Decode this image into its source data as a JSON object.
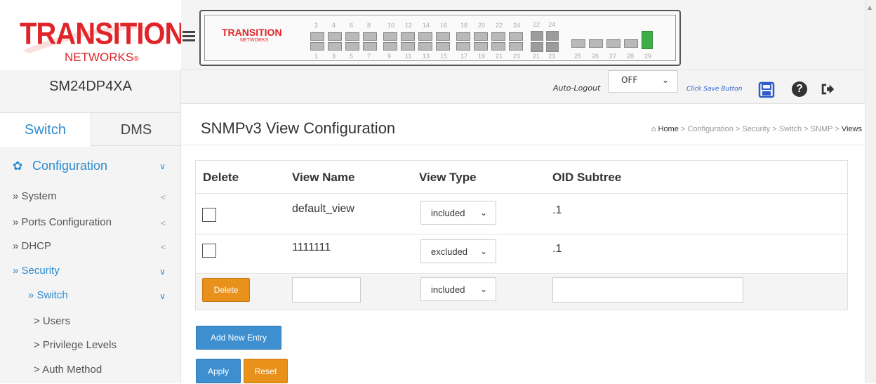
{
  "brand": {
    "logo_top": "TRANSITION",
    "logo_bottom": "NETWORKS",
    "logo_mark": "®"
  },
  "device": {
    "name": "SM24DP4XA"
  },
  "sidebar": {
    "tabs": [
      {
        "label": "Switch"
      },
      {
        "label": "DMS"
      }
    ],
    "items": [
      {
        "label": "Configuration"
      },
      {
        "label": "» System"
      },
      {
        "label": "» Ports Configuration"
      },
      {
        "label": "» DHCP"
      },
      {
        "label": "» Security"
      },
      {
        "label": "» Switch"
      },
      {
        "label": "> Users"
      },
      {
        "label": "> Privilege Levels"
      },
      {
        "label": "> Auth Method"
      }
    ]
  },
  "panel": {
    "logo_top": "TRANSITION",
    "logo_bottom": "NETWORKS",
    "top_numbers": [
      "2",
      "4",
      "6",
      "8",
      "10",
      "12",
      "14",
      "16",
      "18",
      "20",
      "22",
      "24",
      "22",
      "24"
    ],
    "bottom_numbers": [
      "1",
      "3",
      "5",
      "7",
      "9",
      "11",
      "13",
      "15",
      "17",
      "19",
      "21",
      "23",
      "21",
      "23",
      "25",
      "26",
      "27",
      "28",
      "29"
    ]
  },
  "header": {
    "autologout_label": "Auto-Logout",
    "autologout_value": "OFF",
    "click_save": "Click Save Button",
    "icons": [
      "save-icon",
      "help-icon",
      "logout-icon"
    ]
  },
  "page": {
    "title": "SNMPv3 View Configuration",
    "breadcrumb": {
      "home": "Home",
      "path": [
        "Configuration",
        "Security",
        "Switch",
        "SNMP"
      ],
      "current": "Views",
      "sep": ">"
    }
  },
  "table": {
    "headers": [
      "Delete",
      "View Name",
      "View Type",
      "OID Subtree"
    ],
    "rows": [
      {
        "view_name": "default_view",
        "view_type": "included",
        "oid": ".1"
      },
      {
        "view_name": "1111111",
        "view_type": "excluded",
        "oid": ".1"
      }
    ],
    "new_row": {
      "delete_label": "Delete",
      "view_type": "included",
      "view_name": "",
      "oid": ""
    }
  },
  "buttons": {
    "add_new": "Add New Entry",
    "apply": "Apply",
    "reset": "Reset"
  },
  "colors": {
    "accent": "#2d8ccf",
    "brand": "#e0252a",
    "orange": "#e8921c",
    "blue": "#3d8fd0"
  }
}
